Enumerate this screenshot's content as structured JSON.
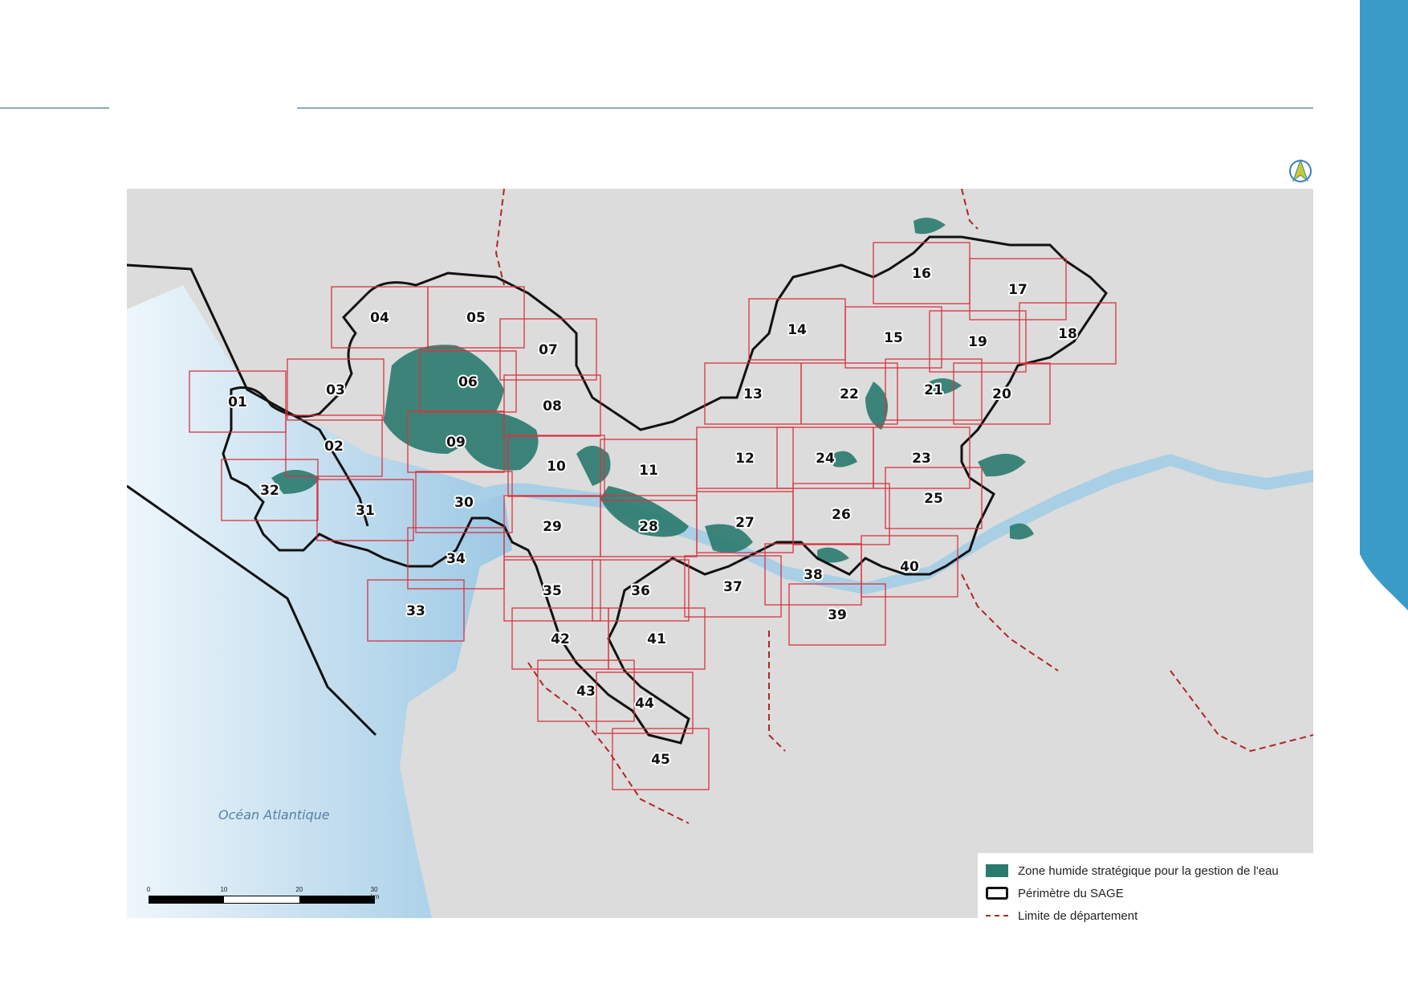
{
  "map": {
    "ocean_label": "Océan Atlantique",
    "scale_ticks": [
      "0",
      "10",
      "20",
      "30 km"
    ],
    "legend": [
      {
        "label": "Zone humide stratégique pour la gestion de l'eau",
        "color": "#2a7a6e"
      },
      {
        "label": "Périmètre du SAGE",
        "color": "#111111"
      },
      {
        "label": "Limite de département",
        "color": "#b02525"
      }
    ],
    "tiles": [
      "01",
      "02",
      "03",
      "04",
      "05",
      "06",
      "07",
      "08",
      "09",
      "10",
      "11",
      "12",
      "13",
      "14",
      "15",
      "16",
      "17",
      "18",
      "19",
      "20",
      "21",
      "22",
      "23",
      "24",
      "25",
      "26",
      "27",
      "28",
      "29",
      "30",
      "31",
      "32",
      "33",
      "34",
      "35",
      "36",
      "37",
      "38",
      "39",
      "40",
      "41",
      "42",
      "43",
      "44",
      "45"
    ],
    "colors": {
      "accent": "#3a9bc8",
      "wetland": "#2a7a6e",
      "tile_frame": "#d9333f",
      "water": "#a8cfe6"
    },
    "icons": [
      "north-arrow-icon"
    ]
  }
}
